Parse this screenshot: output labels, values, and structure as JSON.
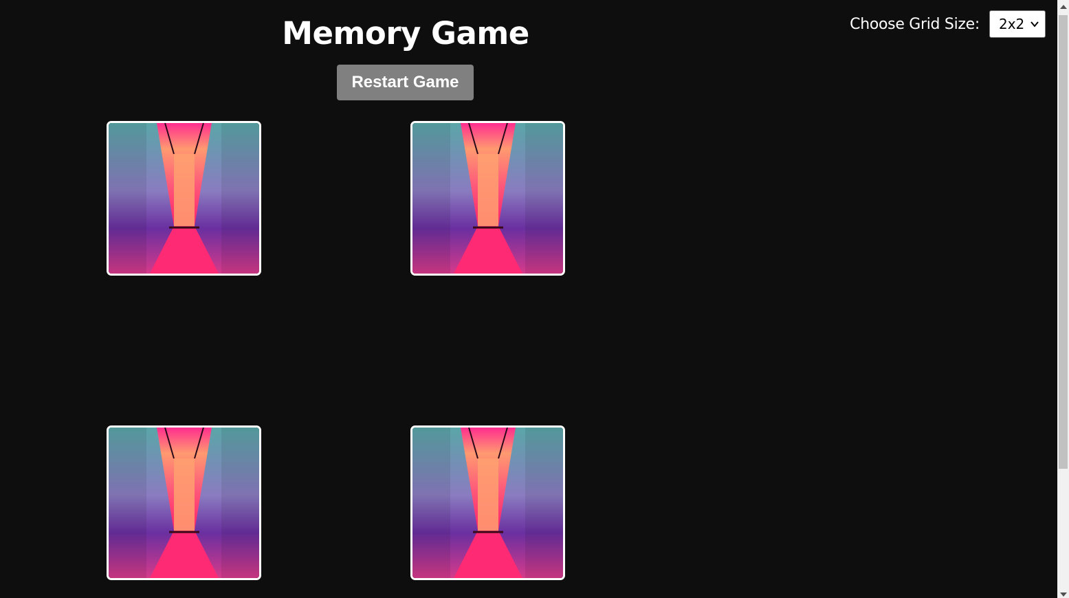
{
  "header": {
    "title": "Memory Game",
    "restart_label": "Restart Game"
  },
  "grid_size": {
    "label": "Choose Grid Size:",
    "selected": "2x2"
  },
  "cards": [
    {
      "image": "neon-hallway-image",
      "state": "face-up"
    },
    {
      "image": "neon-hallway-image",
      "state": "face-up"
    },
    {
      "image": "neon-hallway-image",
      "state": "face-up"
    },
    {
      "image": "neon-hallway-image",
      "state": "face-up"
    }
  ],
  "colors": {
    "background": "#0e0e0e",
    "button": "#808080",
    "card_border": "#ffffff"
  }
}
